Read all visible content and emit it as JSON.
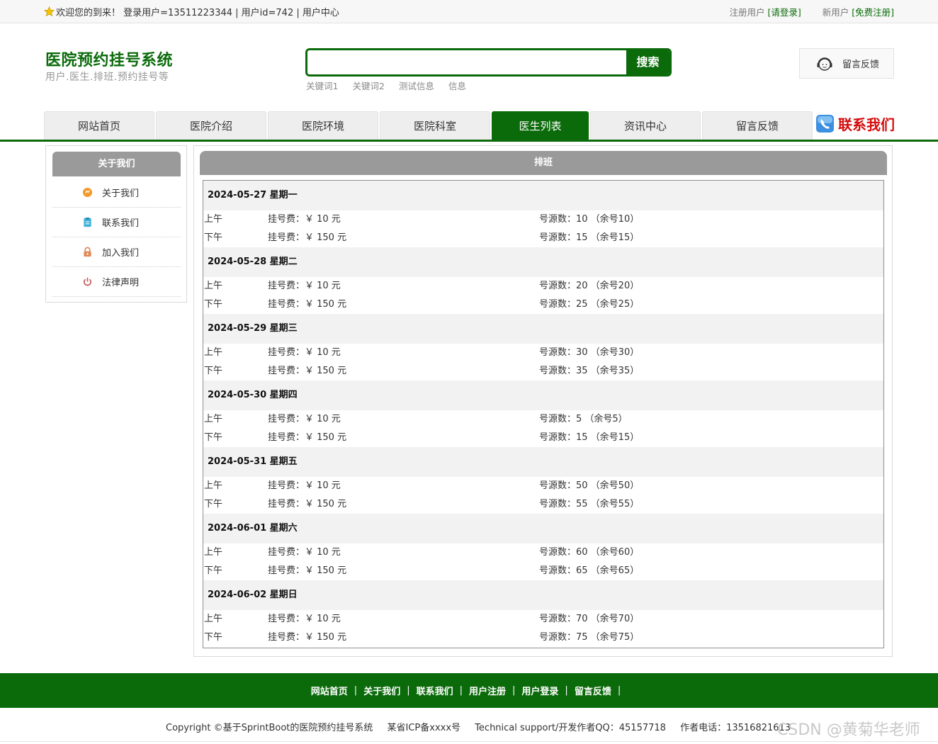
{
  "topbar": {
    "welcome": "欢迎您的到来！ 登录用户=13511223344 | 用户id=742 | 用户中心",
    "reg_user_label": "注册用户",
    "login_link": "[请登录]",
    "new_user_label": "新用户",
    "register_link": "[免费注册]"
  },
  "header": {
    "title": "医院预约挂号系统",
    "subtitle": "用户.医生.排班.预约挂号等",
    "search_value": "",
    "search_button": "搜索",
    "keywords": [
      "关键词1",
      "关键词2",
      "测试信息",
      "信息"
    ],
    "feedback": "留言反馈"
  },
  "nav": {
    "items": [
      "网站首页",
      "医院介绍",
      "医院环境",
      "医院科室",
      "医生列表",
      "资讯中心",
      "留言反馈"
    ],
    "active": "医生列表",
    "contact": "联系我们"
  },
  "sidebar": {
    "title": "关于我们",
    "items": [
      {
        "label": "关于我们",
        "icon": "orange-circle-icon"
      },
      {
        "label": "联系我们",
        "icon": "clipboard-icon"
      },
      {
        "label": "加入我们",
        "icon": "lock-icon"
      },
      {
        "label": "法律声明",
        "icon": "power-icon"
      }
    ]
  },
  "schedule": {
    "title": "排班",
    "days": [
      {
        "date": "2024-05-27 星期一",
        "rows": [
          {
            "period": "上午",
            "fee": "挂号费：￥ 10 元",
            "quota": "号源数：10 （余号10）"
          },
          {
            "period": "下午",
            "fee": "挂号费：￥ 150 元",
            "quota": "号源数：15 （余号15）"
          }
        ]
      },
      {
        "date": "2024-05-28 星期二",
        "rows": [
          {
            "period": "上午",
            "fee": "挂号费：￥ 10 元",
            "quota": "号源数：20 （余号20）"
          },
          {
            "period": "下午",
            "fee": "挂号费：￥ 150 元",
            "quota": "号源数：25 （余号25）"
          }
        ]
      },
      {
        "date": "2024-05-29 星期三",
        "rows": [
          {
            "period": "上午",
            "fee": "挂号费：￥ 10 元",
            "quota": "号源数：30 （余号30）"
          },
          {
            "period": "下午",
            "fee": "挂号费：￥ 150 元",
            "quota": "号源数：35 （余号35）"
          }
        ]
      },
      {
        "date": "2024-05-30 星期四",
        "rows": [
          {
            "period": "上午",
            "fee": "挂号费：￥ 10 元",
            "quota": "号源数：5 （余号5）"
          },
          {
            "period": "下午",
            "fee": "挂号费：￥ 150 元",
            "quota": "号源数：15 （余号15）"
          }
        ]
      },
      {
        "date": "2024-05-31 星期五",
        "rows": [
          {
            "period": "上午",
            "fee": "挂号费：￥ 10 元",
            "quota": "号源数：50 （余号50）"
          },
          {
            "period": "下午",
            "fee": "挂号费：￥ 150 元",
            "quota": "号源数：55 （余号55）"
          }
        ]
      },
      {
        "date": "2024-06-01 星期六",
        "rows": [
          {
            "period": "上午",
            "fee": "挂号费：￥ 10 元",
            "quota": "号源数：60 （余号60）"
          },
          {
            "period": "下午",
            "fee": "挂号费：￥ 150 元",
            "quota": "号源数：65 （余号65）"
          }
        ]
      },
      {
        "date": "2024-06-02 星期日",
        "rows": [
          {
            "period": "上午",
            "fee": "挂号费：￥ 10 元",
            "quota": "号源数：70 （余号70）"
          },
          {
            "period": "下午",
            "fee": "挂号费：￥ 150 元",
            "quota": "号源数：75 （余号75）"
          }
        ]
      }
    ]
  },
  "footer": {
    "links": [
      "网站首页",
      "关于我们",
      "联系我们",
      "用户注册",
      "用户登录",
      "留言反馈"
    ],
    "copyright": "Copyright ©基于SprintBoot的医院预约挂号系统",
    "icp": "某省ICP备xxxx号",
    "support": "Technical support/开发作者QQ：45157718",
    "phone": "作者电话：13516821613",
    "watermark": "CSDN @黄菊华老师"
  },
  "colors": {
    "brand_green": "#0b6b0b",
    "header_gray": "#9a9a9a",
    "contact_red": "#d40c0c"
  }
}
